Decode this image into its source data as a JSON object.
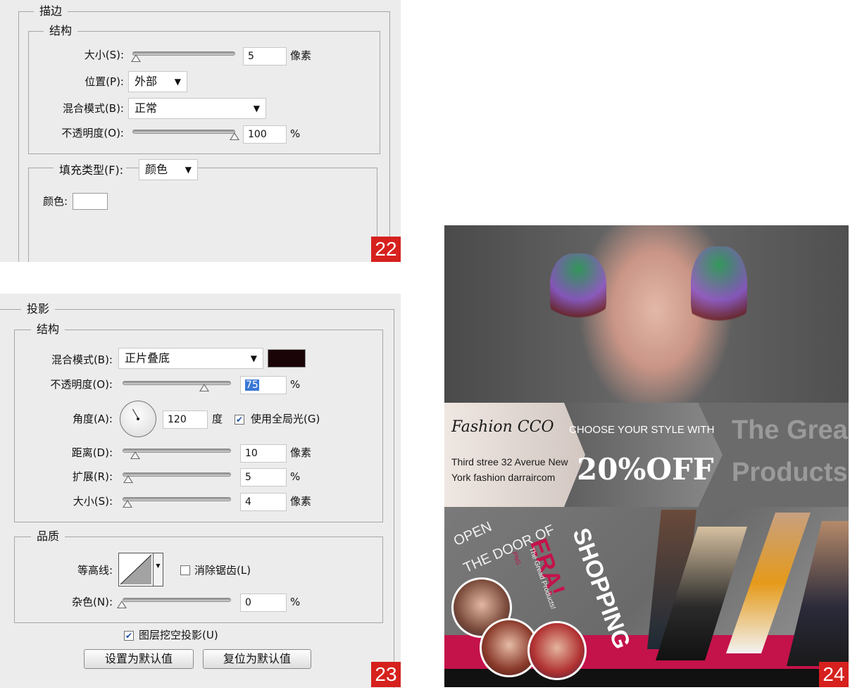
{
  "panel22": {
    "title": "描边",
    "structure_title": "结构",
    "size_label": "大小(S):",
    "size_value": "5",
    "size_unit": "像素",
    "position_label": "位置(P):",
    "position_value": "外部",
    "blend_label": "混合模式(B):",
    "blend_value": "正常",
    "opacity_label": "不透明度(O):",
    "opacity_value": "100",
    "opacity_unit": "%",
    "fill_type_label": "填充类型(F):",
    "fill_type_value": "颜色",
    "color_label": "颜色:",
    "badge": "22"
  },
  "panel23": {
    "title": "投影",
    "structure_title": "结构",
    "blend_label": "混合模式(B):",
    "blend_value": "正片叠底",
    "shadow_color": "#1a0408",
    "opacity_label": "不透明度(O):",
    "opacity_value": "75",
    "opacity_unit": "%",
    "angle_label": "角度(A):",
    "angle_value": "120",
    "angle_unit": "度",
    "global_light_label": "使用全局光(G)",
    "distance_label": "距离(D):",
    "distance_value": "10",
    "distance_unit": "像素",
    "spread_label": "扩展(R):",
    "spread_value": "5",
    "spread_unit": "%",
    "size_label": "大小(S):",
    "size_value": "4",
    "size_unit": "像素",
    "quality_title": "品质",
    "contour_label": "等高线:",
    "antialias_label": "消除锯齿(L)",
    "noise_label": "杂色(N):",
    "noise_value": "0",
    "noise_unit": "%",
    "knockout_label": "图层挖空投影(U)",
    "set_default_label": "设置为默认值",
    "reset_default_label": "复位为默认值",
    "badge": "23"
  },
  "ad": {
    "brand": "Fashion CCO",
    "choose": "CHOOSE YOUR STYLE WITH",
    "address_1": "Third stree 32 Averue New",
    "address_2": "York fashion darraircom",
    "discount": "20%OFF",
    "gread_1": "The Gread",
    "gread_2": "Products!",
    "open": "OPEN",
    "door": "THE DOOR OF",
    "era": "ERA!",
    "shopping": "SHOPPING",
    "small_1": "The Gread Products!",
    "small_2": "PNG",
    "badge": "24",
    "accent": "#c4124a"
  }
}
